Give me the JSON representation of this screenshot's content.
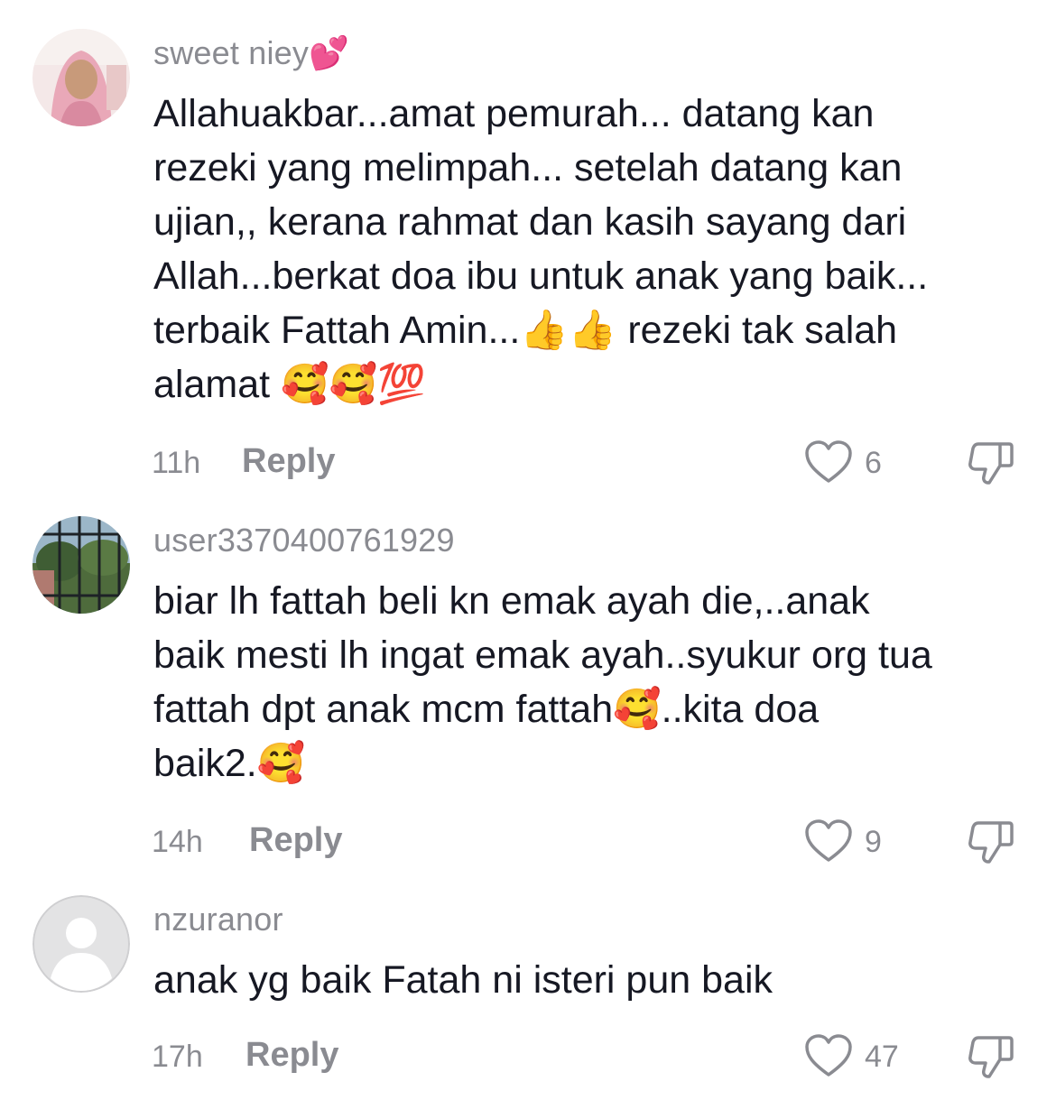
{
  "comments": [
    {
      "username": "sweet niey",
      "username_emoji": "💕",
      "lines": [
        "Allahuakbar...amat pemurah... datang kan",
        "rezeki yang melimpah... setelah datang kan",
        "ujian,, kerana rahmat dan kasih sayang dari",
        "Allah...berkat doa ibu untuk anak yang baik...",
        "terbaik Fattah Amin...👍👍 rezeki tak salah",
        "alamat 🥰🥰💯"
      ],
      "time": "11h",
      "reply_label": "Reply",
      "likes": "6",
      "avatar": "profile-photo-pink-hijab"
    },
    {
      "username": "user3370400761929",
      "lines": [
        "biar lh fattah beli kn emak ayah die,..anak",
        "baik mesti lh ingat emak ayah..syukur org tua",
        "fattah dpt anak mcm fattah🥰..kita doa",
        "baik2.🥰"
      ],
      "time": "14h",
      "reply_label": "Reply",
      "likes": "9",
      "avatar": "profile-photo-garden-gate"
    },
    {
      "username": "nzuranor",
      "lines": [
        "anak yg baik Fatah ni isteri pun baik"
      ],
      "time": "17h",
      "reply_label": "Reply",
      "likes": "47",
      "avatar": "default-avatar"
    }
  ],
  "colors": {
    "text": "#161823",
    "secondary": "#8a8b91",
    "background": "#ffffff"
  },
  "icons": {
    "like": "heart-outline-icon",
    "dislike": "thumbs-down-outline-icon"
  }
}
